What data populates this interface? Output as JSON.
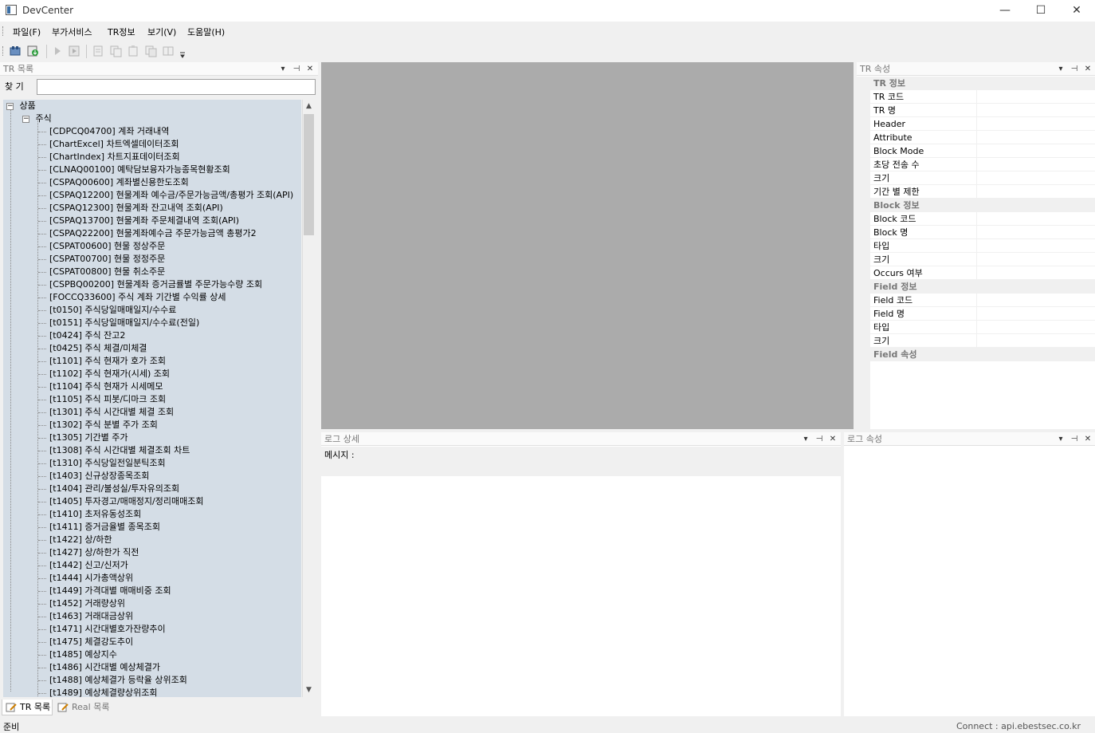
{
  "window": {
    "title": "DevCenter",
    "minimize": "—",
    "maximize": "☐",
    "close": "✕"
  },
  "menu": [
    "파일(F)",
    "부가서비스",
    "TR정보",
    "보기(V)",
    "도움말(H)"
  ],
  "tr_panel": {
    "title": "TR 목록",
    "search_label": "찾 기",
    "search_value": "",
    "root": "상품",
    "group": "주식",
    "items": [
      "[CDPCQ04700] 계좌 거래내역",
      "[ChartExcel] 차트엑셀데이터조회",
      "[ChartIndex] 차트지표데이터조회",
      "[CLNAQ00100] 예탁담보융자가능종목현황조회",
      "[CSPAQ00600] 계좌별신용한도조회",
      "[CSPAQ12200] 현물계좌 예수금/주문가능금액/총평가 조회(API)",
      "[CSPAQ12300] 현물계좌 잔고내역 조회(API)",
      "[CSPAQ13700] 현물계좌 주문체결내역 조회(API)",
      "[CSPAQ22200] 현물계좌예수금 주문가능금액 총평가2",
      "[CSPAT00600] 현물 정상주문",
      "[CSPAT00700] 현물 정정주문",
      "[CSPAT00800] 현물 취소주문",
      "[CSPBQ00200] 현물계좌 증거금률별 주문가능수량 조회",
      "[FOCCQ33600] 주식 계좌 기간별 수익률 상세",
      "[t0150] 주식당일매매일지/수수료",
      "[t0151] 주식당일매매일지/수수료(전일)",
      "[t0424] 주식 잔고2",
      "[t0425] 주식 체결/미체결",
      "[t1101] 주식 현재가 호가 조회",
      "[t1102] 주식 현재가(시세) 조회",
      "[t1104] 주식 현재가 시세메모",
      "[t1105] 주식 피봇/디마크 조회",
      "[t1301] 주식 시간대별 체결 조회",
      "[t1302] 주식 분별 주가 조회",
      "[t1305] 기간별 주가",
      "[t1308] 주식 시간대별 체결조회 차트",
      "[t1310] 주식당일전일분틱조회",
      "[t1403] 신규상장종목조회",
      "[t1404] 관리/불성실/투자유의조회",
      "[t1405] 투자경고/매매정지/정리매매조회",
      "[t1410] 초저유동성조회",
      "[t1411] 증거금율별 종목조회",
      "[t1422] 상/하한",
      "[t1427] 상/하한가 직전",
      "[t1442] 신고/신저가",
      "[t1444] 시가총액상위",
      "[t1449] 가격대별 매매비중 조회",
      "[t1452] 거래량상위",
      "[t1463] 거래대금상위",
      "[t1471] 시간대별호가잔량추이",
      "[t1475] 체결강도추이",
      "[t1485] 예상지수",
      "[t1486] 시간대별 예상체결가",
      "[t1488] 예상체결가 등락율 상위조회",
      "[t1489] 예상체결량상위조회"
    ],
    "tabs": [
      "TR 목록",
      "Real 목록"
    ]
  },
  "prop_panel": {
    "title": "TR 속성",
    "rows": [
      {
        "k": "TR 정보",
        "cat": true
      },
      {
        "k": "TR 코드"
      },
      {
        "k": "TR 명"
      },
      {
        "k": "Header"
      },
      {
        "k": "Attribute"
      },
      {
        "k": "Block Mode"
      },
      {
        "k": "초당 전송 수"
      },
      {
        "k": "크기"
      },
      {
        "k": "기간 별 제한"
      },
      {
        "k": "Block 정보",
        "cat": true
      },
      {
        "k": "Block 코드"
      },
      {
        "k": "Block 명"
      },
      {
        "k": "타입"
      },
      {
        "k": "크기"
      },
      {
        "k": "Occurs 여부"
      },
      {
        "k": "Field 정보",
        "cat": true
      },
      {
        "k": "Field 코드"
      },
      {
        "k": "Field 명"
      },
      {
        "k": "타입"
      },
      {
        "k": "크기"
      },
      {
        "k": "Field 속성",
        "cat": true
      }
    ]
  },
  "log_detail": {
    "title": "로그 상세",
    "message_label": "메시지 :"
  },
  "log_prop": {
    "title": "로그 속성"
  },
  "status": {
    "left": "준비",
    "right": "Connect : api.ebestsec.co.kr"
  },
  "colors": {
    "tree_bg": "#d4dde6",
    "canvas": "#ababab"
  }
}
